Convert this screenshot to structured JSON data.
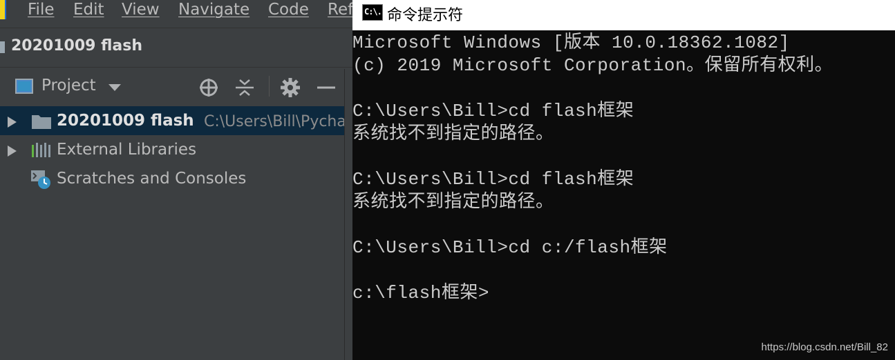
{
  "ide": {
    "menu": [
      "File",
      "Edit",
      "View",
      "Navigate",
      "Code",
      "Ref"
    ],
    "project_title": "20201009 flash",
    "tool_window": {
      "view_label": "Project",
      "icons": [
        "locate-icon",
        "collapse-all-icon",
        "gear-icon",
        "minimize-icon"
      ]
    },
    "tree": [
      {
        "label": "20201009 flash",
        "path": "C:\\Users\\Bill\\Pycha",
        "icon": "folder-icon",
        "expandable": true,
        "selected": true
      },
      {
        "label": "External Libraries",
        "icon": "libraries-icon",
        "expandable": true,
        "selected": false
      },
      {
        "label": "Scratches and Consoles",
        "icon": "scratches-icon",
        "expandable": false,
        "selected": false
      }
    ]
  },
  "cmd": {
    "title": "命令提示符",
    "icon_text": "C:\\.",
    "lines": [
      "Microsoft Windows [版本 10.0.18362.1082]",
      "(c) 2019 Microsoft Corporation。保留所有权利。",
      "",
      "C:\\Users\\Bill>cd flash框架",
      "系统找不到指定的路径。",
      "",
      "C:\\Users\\Bill>cd flash框架",
      "系统找不到指定的路径。",
      "",
      "C:\\Users\\Bill>cd c:/flash框架",
      "",
      "c:\\flash框架>"
    ]
  },
  "watermark": "https://blog.csdn.net/Bill_82",
  "colors": {
    "ide_bg": "#3c3f41",
    "selection": "#0d293e",
    "console_bg": "#0c0c0c",
    "console_text": "#cccccc"
  }
}
